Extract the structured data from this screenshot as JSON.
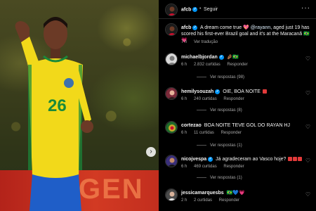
{
  "media": {
    "banner_text": "GEN",
    "next_icon": "›"
  },
  "post": {
    "account": "afcb",
    "dot": "•",
    "follow_label": "Seguir",
    "more_icon": "···"
  },
  "caption": {
    "user": "afcb",
    "text_before": "A dream come true 💖 ",
    "mention": "@rayann",
    "text_after": ", aged just 19 has scored his first-ever Brazil goal and it's at the Maracanã 🇧🇷 💗",
    "time": "7 h",
    "translate": "Ver tradução"
  },
  "comments": [
    {
      "user": "michaelbjordan",
      "text": "🤌🏾🇧🇷",
      "time": "6 h",
      "likes": "2.832 curtidas",
      "reply": "Responder",
      "replies": "Ver respostas (98)"
    },
    {
      "user": "hemilysouzah",
      "text": "OIE, BOA NOITE",
      "time": "6 h",
      "likes": "240 curtidas",
      "reply": "Responder",
      "replies": "Ver respostas (8)"
    },
    {
      "user": "cortezao",
      "text": "BOA NOITE TEVE GOL DO RAYAN HJ",
      "time": "6 h",
      "likes": "11 curtidas",
      "reply": "Responder",
      "replies": "Ver respostas (1)"
    },
    {
      "user": "nicojvespa",
      "text": "Já agradeceram ao Vasco hoje?",
      "time": "6 h",
      "likes": "469 curtidas",
      "reply": "Responder",
      "replies": "Ver respostas (1)"
    },
    {
      "user": "jessicamarquesbs",
      "text": "🇧🇷💙💗",
      "time": "2 h",
      "likes": "2 curtidas",
      "reply": "Responder"
    }
  ],
  "colors": {
    "jersey": "#f2d91a",
    "shorts": "#1f5ec8",
    "link": "#e0f1ff",
    "verified": "#0095f6"
  }
}
